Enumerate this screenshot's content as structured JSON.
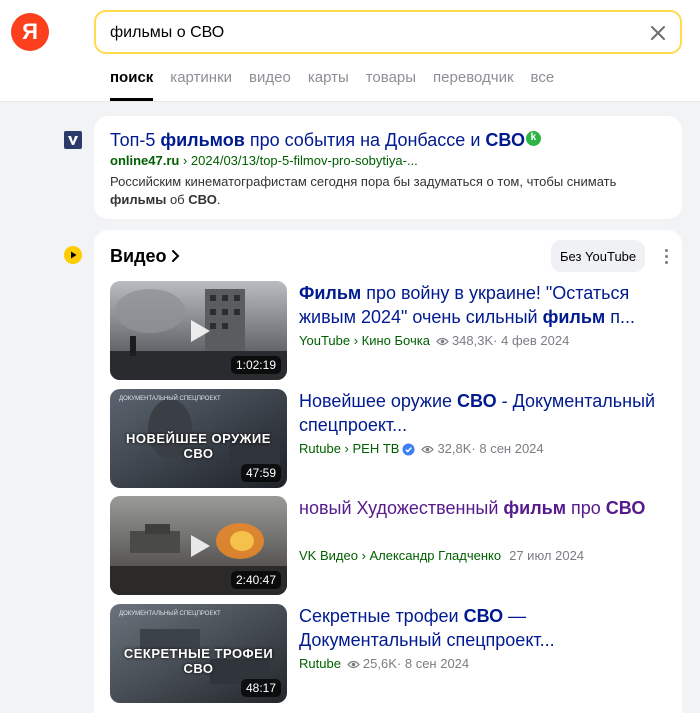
{
  "header": {
    "logo_letter": "Я",
    "search_value": "фильмы о СВО",
    "tabs": [
      "поиск",
      "картинки",
      "видео",
      "карты",
      "товары",
      "переводчик",
      "все"
    ]
  },
  "result": {
    "title_pre": "Топ-5 ",
    "title_bold1": "фильмов",
    "title_mid": " про события на Донбассе и ",
    "title_bold2": "СВО",
    "badge": "k",
    "url_domain": "online47.ru",
    "url_path": " › 2024/03/13/top-5-filmov-pro-sobytiya-...",
    "snippet_1": "Российским кинематографистам сегодня пора бы задуматься о том, чтобы снимать ",
    "snippet_bold1": "фильмы",
    "snippet_2": " об ",
    "snippet_bold2": "СВО",
    "snippet_3": "."
  },
  "videos": {
    "heading": "Видео",
    "no_youtube": "Без YouTube",
    "items": [
      {
        "t1b": "Фильм",
        "t2": " про войну в украине! \"Остаться живым 2024\" очень сильный ",
        "t3b": "фильм",
        "t4": " п...",
        "source": "YouTube › Кино Бочка",
        "views": "348,3K",
        "date": " · 4 фев 2024",
        "duration": "1:02:19"
      },
      {
        "t1": "Новейшее оружие ",
        "t2b": "СВО",
        "t3": " - Документальный спецпроект...",
        "source": "Rutube › РЕН ТВ",
        "views": "32,8K",
        "date": " · 8 сен 2024",
        "duration": "47:59",
        "caption": "НОВЕЙШЕЕ ОРУЖИЕ СВО",
        "tag": "ДОКУМЕНТАЛЬНЫЙ СПЕЦПРОЕКТ"
      },
      {
        "t1": "новый Художественный ",
        "t2b": "фильм",
        "t3": " про ",
        "t4b": "СВО",
        "source": "VK Видео › Александр Гладченко",
        "date": "27 июл 2024",
        "duration": "2:40:47"
      },
      {
        "t1": "Секретные трофеи ",
        "t2b": "СВО",
        "t3": " — Документальный спецпроект...",
        "source": "Rutube",
        "views": "25,6K",
        "date": " · 8 сен 2024",
        "duration": "48:17",
        "caption": "СЕКРЕТНЫЕ ТРОФЕИ СВО",
        "tag": "ДОКУМЕНТАЛЬНЫЙ СПЕЦПРОЕКТ"
      }
    ]
  },
  "colors": {
    "accent_yellow": "#ffdb4d",
    "logo_red": "#fc3f1d",
    "link_blue": "#001a8f",
    "visited_purple": "#551a8b",
    "url_green": "#006000"
  }
}
